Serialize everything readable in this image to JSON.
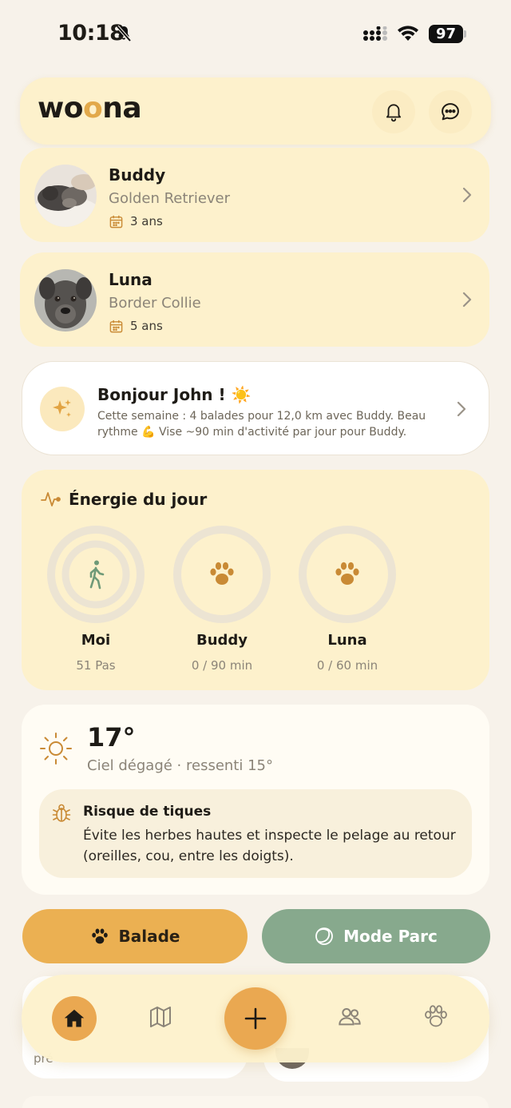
{
  "status_bar": {
    "time": "10:18",
    "battery": "97"
  },
  "header": {
    "logo_pre": "wo",
    "logo_o": "o",
    "logo_post": "na"
  },
  "pets": [
    {
      "name": "Buddy",
      "breed": "Golden Retriever",
      "age": "3 ans"
    },
    {
      "name": "Luna",
      "breed": "Border Collie",
      "age": "5 ans"
    }
  ],
  "greeting": {
    "title": "Bonjour John ! ☀️",
    "text": "Cette semaine : 4 balades pour 12,0 km avec Buddy. Beau rythme 💪 Vise ~90 min d'activité par jour pour Buddy."
  },
  "energy": {
    "title": "Énergie du jour",
    "rings": [
      {
        "label": "Moi",
        "sub": "51 Pas",
        "icon": "walking-person-icon",
        "color": "#6f9a78"
      },
      {
        "label": "Buddy",
        "sub": "0 / 90 min",
        "icon": "paw-icon",
        "color": "#c98a35"
      },
      {
        "label": "Luna",
        "sub": "0 / 60 min",
        "icon": "paw-icon",
        "color": "#c98a35"
      }
    ]
  },
  "weather": {
    "temp": "17°",
    "sky": "Ciel dégagé · ressenti 15°",
    "alert_title": "Risque de tiques",
    "alert_text": "Évite les herbes hautes et inspecte le pelage au retour (oreilles, cou, entre les doigts)."
  },
  "actions": {
    "balade": "Balade",
    "parc": "Mode Parc"
  },
  "peek": {
    "text": "pré"
  },
  "colors": {
    "accent": "#eaa851",
    "green": "#87a98d",
    "card": "#fdf1cc",
    "background": "#f7f2ea"
  }
}
